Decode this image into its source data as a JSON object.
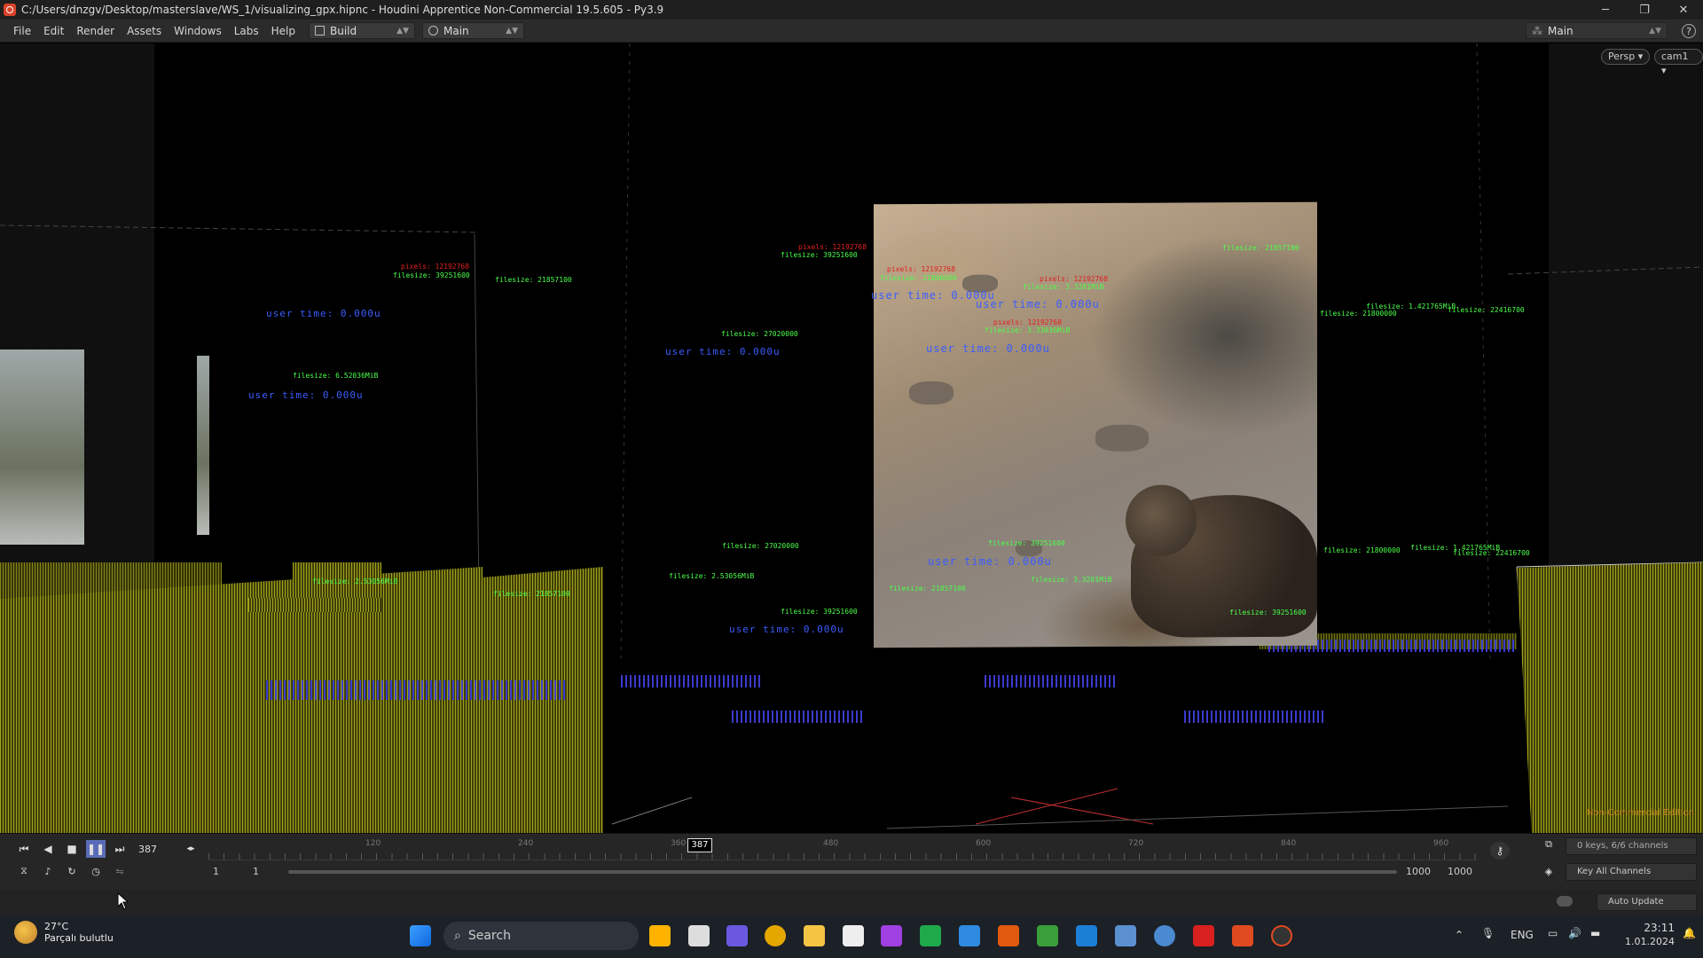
{
  "titlebar": {
    "title": "C:/Users/dnzgv/Desktop/masterslave/WS_1/visualizing_gpx.hipnc - Houdini Apprentice Non-Commercial 19.5.605 - Py3.9",
    "minimize": "─",
    "restore": "❐",
    "close": "✕"
  },
  "menu": {
    "items": [
      "File",
      "Edit",
      "Render",
      "Assets",
      "Windows",
      "Labs",
      "Help"
    ],
    "desktop_build": "Build",
    "desktop_main": "Main",
    "right_desktop": "Main",
    "help": "?"
  },
  "viewport": {
    "persp": "Persp ▾",
    "cam": "cam1 ▾",
    "watermark": "Non-Commercial Edition",
    "overlay_labels": {
      "user_time": "user time: 0.000u",
      "filesize_1": "filesize: 39251600",
      "filesize_2": "filesize: 21857100",
      "filesize_3": "filesize: 6.52036MiB",
      "filesize_4": "filesize: 27020000",
      "filesize_5": "filesize: 22416700",
      "filesize_6": "filesize: 21800000",
      "filesize_7": "filesize: 3.33036MiB",
      "filesize_8": "filesize: 21857100",
      "filesize_9": "filesize: 3.3201MiB",
      "filesize_10": "filesize: 1.421765MiB",
      "filesize_11": "filesize: 21800000",
      "filesize_12": "filesize: 22416700",
      "filesize_13": "filesize: 2.53056MiB",
      "pixels": "pixels: 12192768"
    }
  },
  "timeline": {
    "current_frame": "387",
    "cursor_frame": "387",
    "ruler_ticks": [
      "120",
      "240",
      "360",
      "480",
      "600",
      "720",
      "840",
      "960"
    ],
    "start_a": "1",
    "start_b": "1",
    "end_a": "1000",
    "end_b": "1000",
    "keys_status": "0 keys, 6/6 channels",
    "key_all": "Key All Channels",
    "auto_update": "Auto Update"
  },
  "taskbar": {
    "temperature": "27°C",
    "weather_desc": "Parçalı bulutlu",
    "search": "Search",
    "lang": "ENG",
    "time": "23:11",
    "date": "1.01.2024"
  },
  "colors": {
    "label_red": "#e02020",
    "label_green": "#4cff4c",
    "label_blue": "#3b5cff",
    "grid_yellow": "#a3a31a"
  }
}
